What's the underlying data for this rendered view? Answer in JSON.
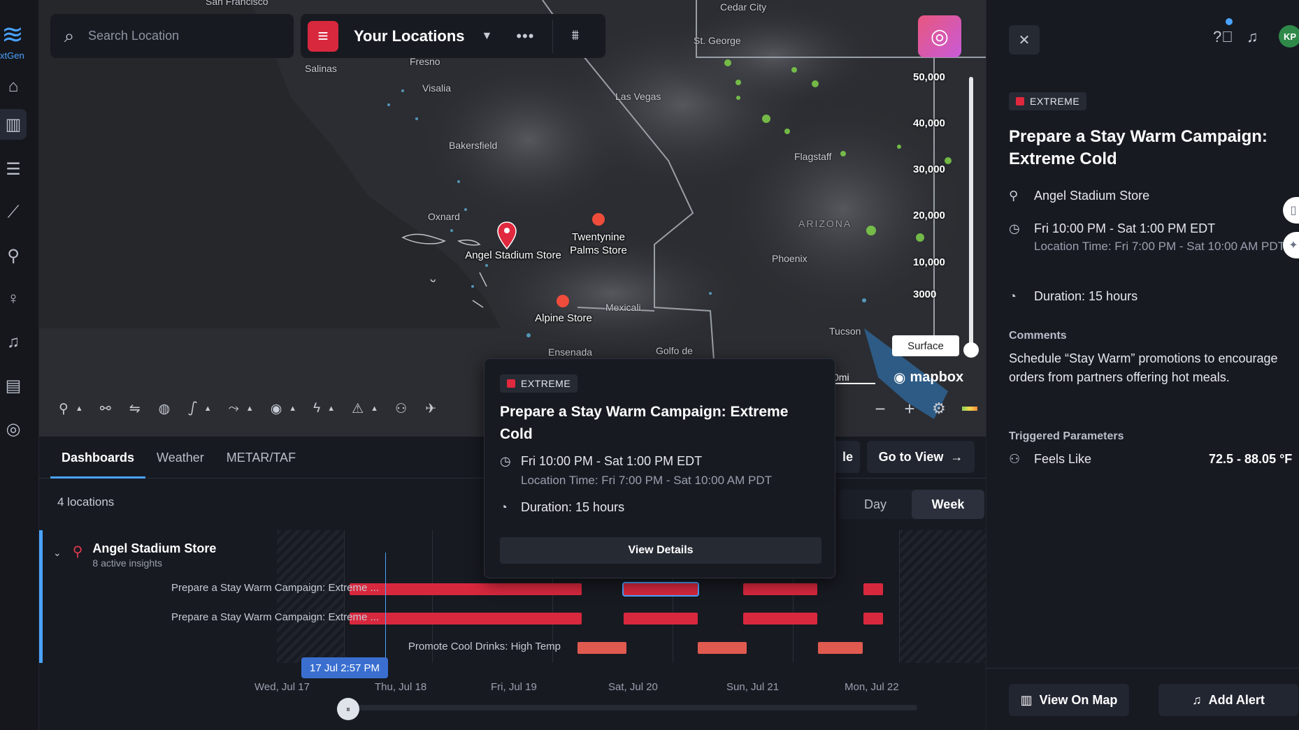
{
  "brand": {
    "logo_text": "xtGen"
  },
  "search": {
    "placeholder": "Search Location"
  },
  "locations": {
    "title": "Your Locations"
  },
  "map": {
    "altitudes": [
      "50,000",
      "40,000",
      "30,000",
      "20,000",
      "10,000",
      "3000"
    ],
    "surface_label": "Surface",
    "scale_label": "0mi",
    "attribution": "mapbox",
    "cities": [
      {
        "name": "San Francisco"
      },
      {
        "name": "Fresno"
      },
      {
        "name": "Salinas"
      },
      {
        "name": "Visalia"
      },
      {
        "name": "Bakersfield"
      },
      {
        "name": "Las Vegas"
      },
      {
        "name": "St. George"
      },
      {
        "name": "Cedar City"
      },
      {
        "name": "Flagstaff"
      },
      {
        "name": "ARIZONA"
      },
      {
        "name": "Phoenix"
      },
      {
        "name": "Tucson"
      },
      {
        "name": "Oxnard"
      },
      {
        "name": "Mexicali"
      },
      {
        "name": "Ensenada"
      },
      {
        "name": "Golfo de"
      }
    ],
    "stores": [
      {
        "name": "Angel Stadium Store"
      },
      {
        "name": "Twentynine Palms Store"
      },
      {
        "name": "Alpine Store"
      }
    ]
  },
  "tabs": [
    "Dashboards",
    "Weather",
    "METAR/TAF"
  ],
  "bottom": {
    "count_label": "4 locations",
    "go_to_view": "Go to View",
    "partial_button": "le",
    "day": "Day",
    "week": "Week",
    "store": {
      "name": "Angel Stadium Store",
      "sub": "8 active insights"
    },
    "rows": [
      "Prepare a Stay Warm Campaign: Extreme ...",
      "Prepare a Stay Warm Campaign: Extreme ...",
      "Promote Cool Drinks: High Temp"
    ],
    "axis_labels": [
      "Wed, Jul 17",
      "Thu, Jul 18",
      "Fri, Jul 19",
      "Sat, Jul 20",
      "Sun, Jul 21",
      "Mon, Jul 22"
    ],
    "current_time": "17 Jul 2:57 PM"
  },
  "popup": {
    "severity": "EXTREME",
    "title": "Prepare a Stay Warm Campaign: Extreme Cold",
    "time": "Fri 10:00 PM - Sat 1:00 PM EDT",
    "local_time": "Location Time: Fri 7:00 PM - Sat 10:00 AM PDT",
    "duration": "Duration: 15 hours",
    "button": "View Details"
  },
  "detail": {
    "severity": "EXTREME",
    "title": "Prepare a Stay Warm Campaign: Extreme Cold",
    "location": "Angel Stadium Store",
    "time": "Fri 10:00 PM - Sat 1:00 PM EDT",
    "local_time": "Location Time: Fri 7:00 PM - Sat 10:00 AM PDT",
    "duration": "Duration: 15 hours",
    "comments_header": "Comments",
    "comments": "Schedule “Stay Warm” promotions to encourage orders from partners offering hot meals.",
    "params_header": "Triggered Parameters",
    "param_name": "Feels Like",
    "param_value": "72.5 - 88.05 °F",
    "avatar": "KP",
    "view_on_map": "View On Map",
    "add_alert": "Add Alert"
  },
  "colors": {
    "accent": "#4aa3ff",
    "extreme": "#d8283e",
    "panel": "#171a21"
  }
}
